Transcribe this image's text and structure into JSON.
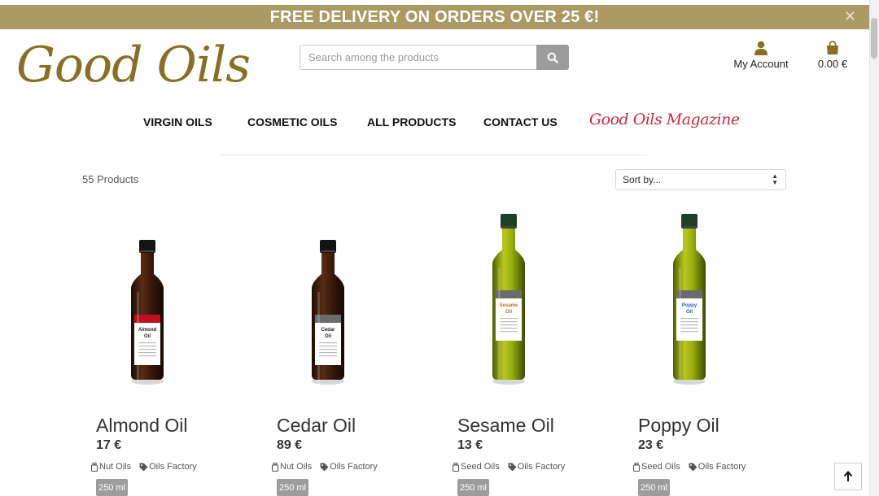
{
  "banner": {
    "text": "FREE DELIVERY ON ORDERS OVER 25 €!",
    "close": "✕"
  },
  "logo": {
    "text": "Good Oils"
  },
  "search": {
    "placeholder": "Search among the products",
    "icon": "search-icon"
  },
  "header": {
    "account_label": "My Account",
    "cart_total": "0.00 €"
  },
  "nav": {
    "items": [
      "VIRGIN OILS",
      "COSMETIC OILS",
      "ALL PRODUCTS",
      "CONTACT US"
    ],
    "magazine": "Good Oils Magazine"
  },
  "catalog": {
    "count": "55 Products",
    "sort_label": "Sort by..."
  },
  "products": [
    {
      "name": "Almond Oil",
      "price": "17 €",
      "type": "Nut Oils",
      "brand": "Oils Factory",
      "size": "250 ml",
      "label_lines": [
        "Almond",
        "Oil"
      ],
      "glass": "dark",
      "label_color": "#c0101e",
      "text_color": "#222222"
    },
    {
      "name": "Cedar Oil",
      "price": "89 €",
      "type": "Nut Oils",
      "brand": "Oils Factory",
      "size": "250 ml",
      "label_lines": [
        "Cedar",
        "Oil"
      ],
      "glass": "dark",
      "label_color": "#6b6b6b",
      "text_color": "#222222"
    },
    {
      "name": "Sesame Oil",
      "price": "13 €",
      "type": "Seed Oils",
      "brand": "Oils Factory",
      "size": "250 ml",
      "label_lines": [
        "Sesame",
        "Oil"
      ],
      "glass": "green",
      "label_color": "#6b6b6b",
      "text_color": "#d4671c"
    },
    {
      "name": "Poppy Oil",
      "price": "23 €",
      "type": "Seed Oils",
      "brand": "Oils Factory",
      "size": "250 ml",
      "label_lines": [
        "Poppy",
        "Oil"
      ],
      "glass": "green",
      "label_color": "#6b6b6b",
      "text_color": "#2b59c3"
    }
  ],
  "colors": {
    "banner": "#ab9a64",
    "brand": "#8a6f23",
    "magazine": "#c92a3a",
    "button_gray": "#9c9c9c"
  }
}
